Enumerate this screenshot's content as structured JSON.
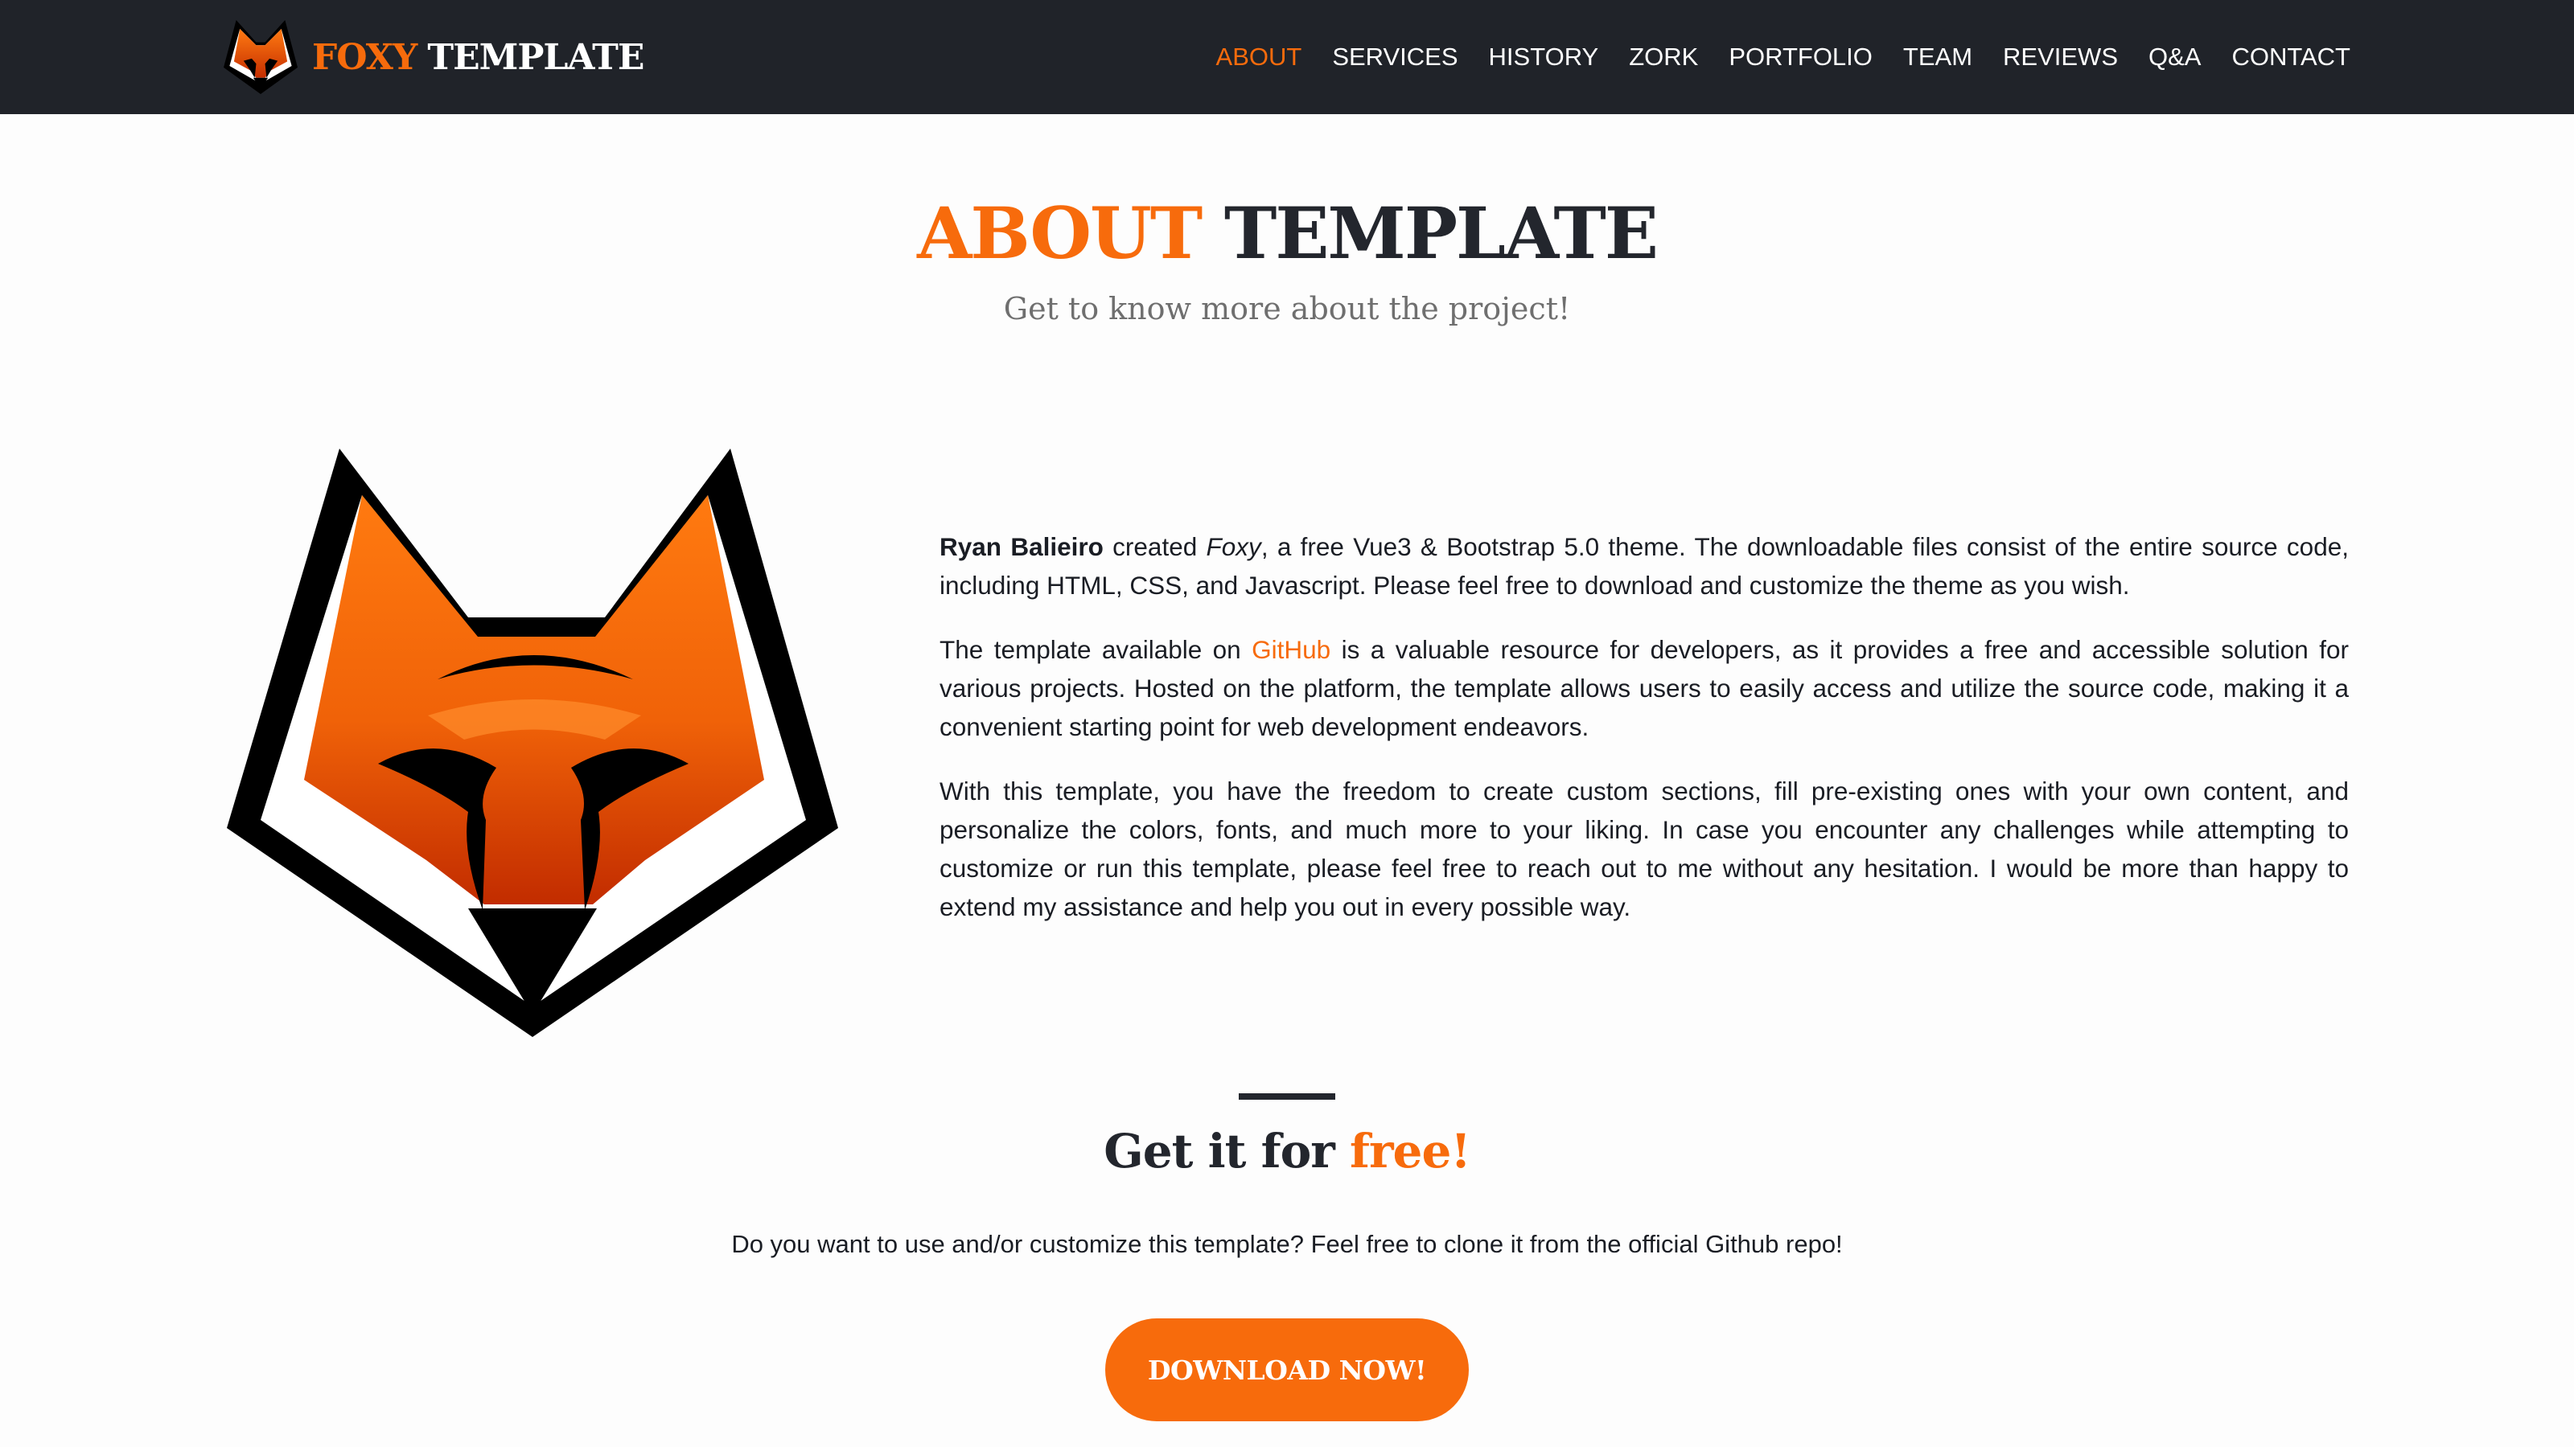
{
  "header": {
    "brand_accent": "FOXY",
    "brand_rest": "TEMPLATE",
    "logo_icon": "fox-head-icon",
    "nav": [
      {
        "label": "ABOUT",
        "active": true
      },
      {
        "label": "SERVICES"
      },
      {
        "label": "HISTORY"
      },
      {
        "label": "ZORK"
      },
      {
        "label": "PORTFOLIO"
      },
      {
        "label": "TEAM"
      },
      {
        "label": "REVIEWS"
      },
      {
        "label": "Q&A"
      },
      {
        "label": "CONTACT"
      }
    ]
  },
  "about": {
    "title_accent": "ABOUT",
    "title_rest": "TEMPLATE",
    "subtitle": "Get to know more about the project!",
    "logo_icon": "fox-head-icon",
    "p1": {
      "author": "Ryan Balieiro",
      "created": "created",
      "name": "Foxy",
      "rest": ", a free Vue3 & Bootstrap 5.0 theme. The downloadable files consist of the entire source code, including HTML, CSS, and Javascript. Please feel free to download and customize the theme as you wish."
    },
    "p2": {
      "before": "The template available on",
      "link": "GitHub",
      "after": "is a valuable resource for developers, as it provides a free and accessible solution for various projects. Hosted on the platform, the template allows users to easily access and utilize the source code, making it a convenient starting point for web development endeavors."
    },
    "p3": "With this template, you have the freedom to create custom sections, fill pre-existing ones with your own content, and personalize the colors, fonts, and much more to your liking. In case you encounter any challenges while attempting to customize or run this template, please feel free to reach out to me without any hesitation. I would be more than happy to extend my assistance and help you out in every possible way."
  },
  "cta": {
    "title": "Get it for",
    "title_accent": "free!",
    "text": "Do you want to use and/or customize this template? Feel free to clone it from the official Github repo!",
    "button": "DOWNLOAD NOW!"
  },
  "colors": {
    "accent": "#f76b0c",
    "navbar": "#202329",
    "heading": "#23262d",
    "background": "#fdfdfd"
  }
}
